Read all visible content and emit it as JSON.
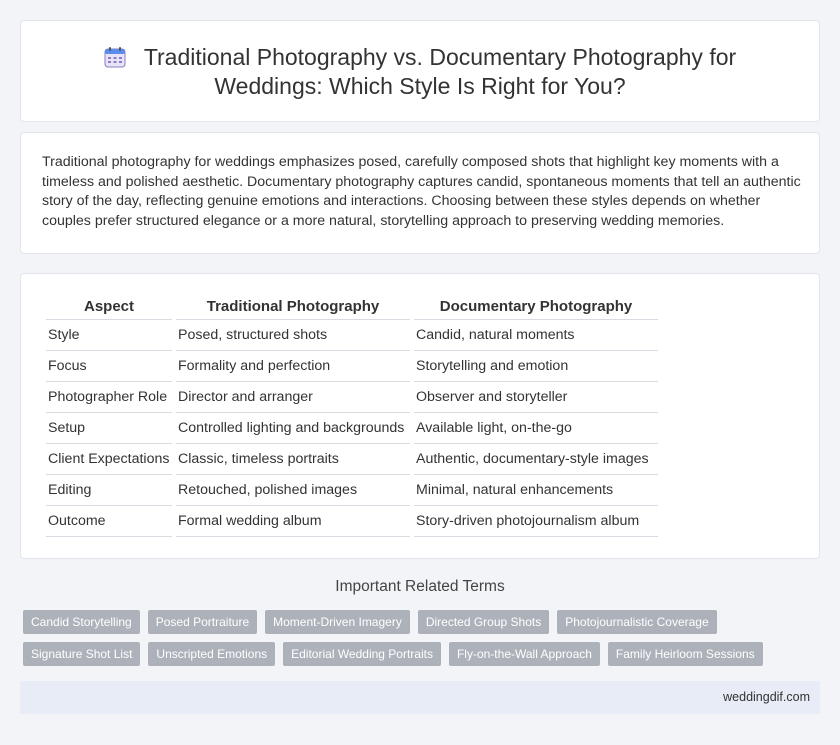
{
  "header": {
    "icon": "calendar-icon",
    "title_line1": "Traditional Photography vs. Documentary Photography for",
    "title_line2": "Weddings: Which Style Is Right for You?"
  },
  "intro": {
    "text": "Traditional photography for weddings emphasizes posed, carefully composed shots that highlight key moments with a timeless and polished aesthetic. Documentary photography captures candid, spontaneous moments that tell an authentic story of the day, reflecting genuine emotions and interactions. Choosing between these styles depends on whether couples prefer structured elegance or a more natural, storytelling approach to preserving wedding memories."
  },
  "table": {
    "headers": [
      "Aspect",
      "Traditional Photography",
      "Documentary Photography"
    ],
    "rows": [
      [
        "Style",
        "Posed, structured shots",
        "Candid, natural moments"
      ],
      [
        "Focus",
        "Formality and perfection",
        "Storytelling and emotion"
      ],
      [
        "Photographer Role",
        "Director and arranger",
        "Observer and storyteller"
      ],
      [
        "Setup",
        "Controlled lighting and backgrounds",
        "Available light, on-the-go"
      ],
      [
        "Client Expectations",
        "Classic, timeless portraits",
        "Authentic, documentary-style images"
      ],
      [
        "Editing",
        "Retouched, polished images",
        "Minimal, natural enhancements"
      ],
      [
        "Outcome",
        "Formal wedding album",
        "Story-driven photojournalism album"
      ]
    ]
  },
  "related": {
    "title": "Important Related Terms",
    "tags_row1": [
      "Candid Storytelling",
      "Posed Portraiture",
      "Moment-Driven Imagery",
      "Directed Group Shots",
      "Photojournalistic Coverage"
    ],
    "tags_row2": [
      "Signature Shot List",
      "Unscripted Emotions",
      "Editorial Wedding Portraits",
      "Fly-on-the-Wall Approach",
      "Family Heirloom Sessions"
    ]
  },
  "footer": {
    "site": "weddingdif.com"
  },
  "colors": {
    "page_bg": "#f3f4f8",
    "tag_bg": "#adb2ba",
    "footer_bg": "#e8ecf6",
    "icon_accent": "#5b8def"
  }
}
